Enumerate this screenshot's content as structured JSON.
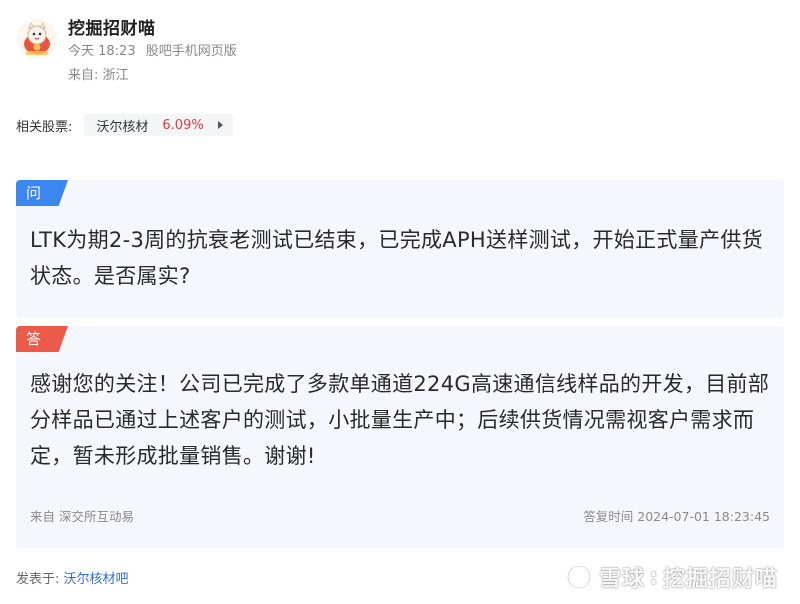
{
  "post": {
    "author": "挖掘招财喵",
    "time": "今天 18:23",
    "client": "股吧手机网页版",
    "location": "来自: 浙江"
  },
  "related": {
    "label": "相关股票:",
    "stock_name": "沃尔核材",
    "stock_change": "6.09%",
    "change_color": "#e03a3a"
  },
  "question": {
    "tag": "问",
    "text": "LTK为期2-3周的抗衰老测试已结束，已完成APH送样测试，开始正式量产供货状态。是否属实?"
  },
  "answer": {
    "tag": "答",
    "text": "感谢您的关注！公司已完成了多款单通道224G高速通信线样品的开发，目前部分样品已通过上述客户的测试，小批量生产中；后续供货情况需视客户需求而定，暂未形成批量销售。谢谢!",
    "source": "来自 深交所互动易",
    "reply_time": "答复时间 2024-07-01 18:23:45"
  },
  "footer": {
    "posted_in_label": "发表于:",
    "forum": "沃尔核材吧"
  },
  "watermark": {
    "brand": "雪球",
    "separator": ":",
    "account": "挖掘招财喵"
  },
  "colors": {
    "question_tag": "#3b87f0",
    "answer_tag": "#ec5a4a",
    "card_bg": "#f4f7fb",
    "link": "#2f6fd6"
  },
  "icons": {
    "avatar": "cartoon-cat-avatar",
    "chip_arrow": "caret-right-icon",
    "watermark_logo": "snowball-logo-icon"
  }
}
